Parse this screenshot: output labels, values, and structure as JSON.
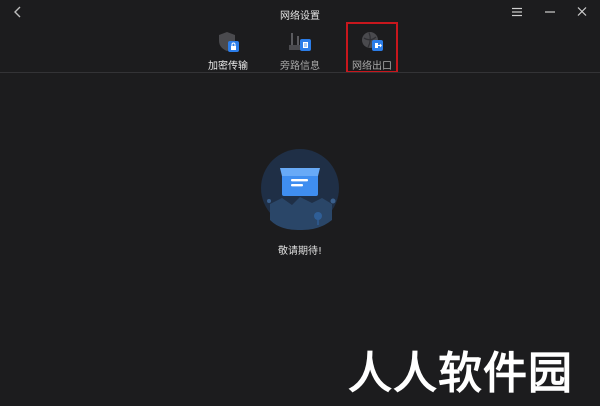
{
  "window": {
    "title": "网络设置"
  },
  "tabs": [
    {
      "label": "加密传输",
      "icon": "shield-lock-icon"
    },
    {
      "label": "旁路信息",
      "icon": "bypass-info-icon"
    },
    {
      "label": "网络出口",
      "icon": "network-exit-icon"
    }
  ],
  "main": {
    "empty_message": "敬请期待!"
  },
  "watermark": "人人软件园",
  "colors": {
    "background": "#1c1c1e",
    "accent": "#2b7de9",
    "highlight": "#c8171d"
  }
}
